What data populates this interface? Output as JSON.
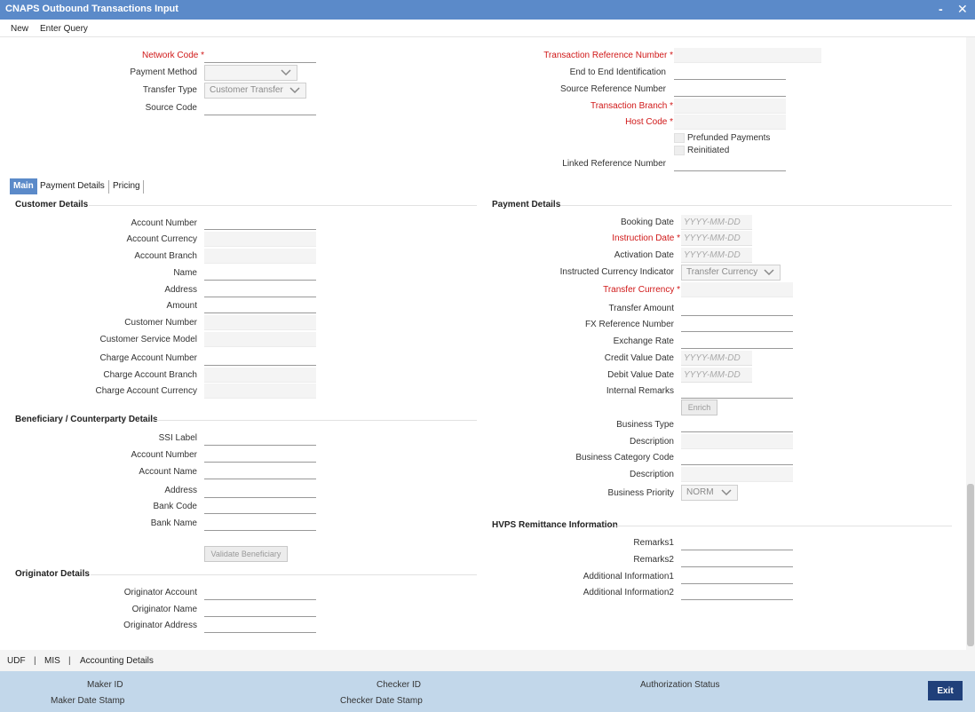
{
  "window": {
    "title": "CNAPS Outbound Transactions Input",
    "minimize": "-",
    "close": "✕"
  },
  "menu": {
    "new": "New",
    "enter_query": "Enter Query"
  },
  "header": {
    "network_code": "Network Code",
    "payment_method": "Payment Method",
    "transfer_type": "Transfer Type",
    "transfer_type_value": "Customer Transfer",
    "source_code": "Source Code",
    "txn_ref": "Transaction Reference Number",
    "e2e": "End to End Identification",
    "src_ref": "Source Reference Number",
    "txn_branch": "Transaction Branch",
    "host_code": "Host Code",
    "prefunded": "Prefunded Payments",
    "reinitiated": "Reinitiated",
    "linked_ref": "Linked Reference Number"
  },
  "tabs": {
    "main": "Main",
    "payment_details": "Payment Details",
    "pricing": "Pricing"
  },
  "customer": {
    "title": "Customer Details",
    "account_number": "Account Number",
    "account_currency": "Account Currency",
    "account_branch": "Account Branch",
    "name": "Name",
    "address": "Address",
    "amount": "Amount",
    "customer_number": "Customer Number",
    "service_model": "Customer Service Model",
    "charge_account_number": "Charge Account Number",
    "charge_account_branch": "Charge Account Branch",
    "charge_account_currency": "Charge Account Currency"
  },
  "beneficiary": {
    "title": "Beneficiary / Counterparty Details",
    "ssi_label": "SSI Label",
    "account_number": "Account Number",
    "account_name": "Account Name",
    "address": "Address",
    "bank_code": "Bank Code",
    "bank_name": "Bank Name",
    "validate_button": "Validate Beneficiary"
  },
  "originator": {
    "title": "Originator Details",
    "account": "Originator Account",
    "name": "Originator Name",
    "address": "Originator Address"
  },
  "payment": {
    "title": "Payment Details",
    "booking_date": "Booking Date",
    "instruction_date": "Instruction Date",
    "activation_date": "Activation Date",
    "instructed_currency_indicator": "Instructed Currency Indicator",
    "instructed_currency_value": "Transfer Currency",
    "transfer_currency": "Transfer Currency",
    "transfer_amount": "Transfer Amount",
    "fx_ref": "FX Reference Number",
    "exchange_rate": "Exchange Rate",
    "credit_value_date": "Credit Value Date",
    "debit_value_date": "Debit Value Date",
    "internal_remarks": "Internal Remarks",
    "enrich_button": "Enrich",
    "business_type": "Business Type",
    "description1": "Description",
    "business_category_code": "Business Category Code",
    "description2": "Description",
    "business_priority": "Business Priority",
    "business_priority_value": "NORM",
    "date_placeholder": "YYYY-MM-DD"
  },
  "hvps": {
    "title": "HVPS Remittance Information",
    "remarks1": "Remarks1",
    "remarks2": "Remarks2",
    "add_info1": "Additional Information1",
    "add_info2": "Additional Information2"
  },
  "subbar": {
    "udf": "UDF",
    "mis": "MIS",
    "accounting": "Accounting Details",
    "sep": "|"
  },
  "footer": {
    "maker_id": "Maker ID",
    "maker_date": "Maker Date Stamp",
    "checker_id": "Checker ID",
    "checker_date": "Checker Date Stamp",
    "auth_status": "Authorization Status",
    "exit": "Exit"
  }
}
